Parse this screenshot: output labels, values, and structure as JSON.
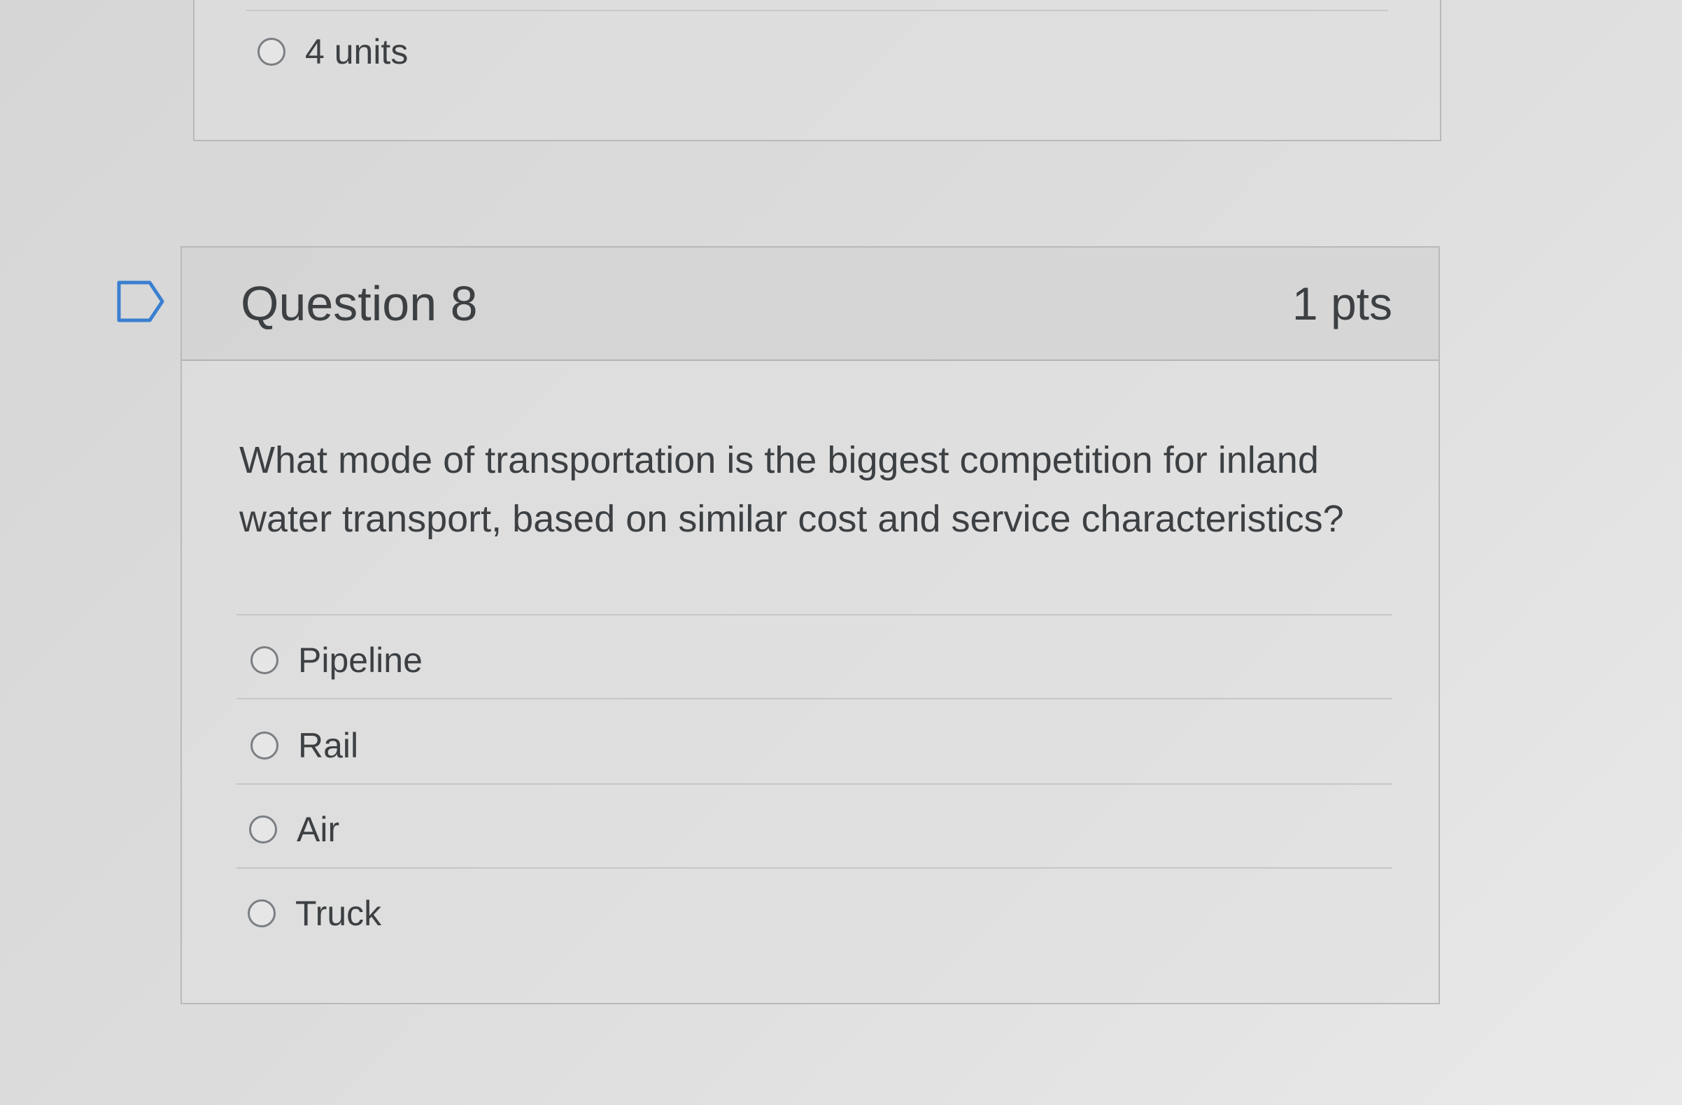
{
  "previous_question": {
    "answers": [
      {
        "label": "4 units",
        "selected": false
      }
    ]
  },
  "question": {
    "flag_icon": "bookmark-flag-icon",
    "title": "Question 8",
    "points": "1 pts",
    "text": "What mode of transportation is the biggest competition for inland water transport, based on similar cost and service characteristics?",
    "answers": [
      {
        "label": "Pipeline",
        "selected": false
      },
      {
        "label": "Rail",
        "selected": false
      },
      {
        "label": "Air",
        "selected": false
      },
      {
        "label": "Truck",
        "selected": false
      }
    ]
  },
  "colors": {
    "border": "#b9b9b9",
    "header_bg": "#cdcdcd",
    "text": "#3d4043",
    "radio_border": "#7b7f83"
  }
}
